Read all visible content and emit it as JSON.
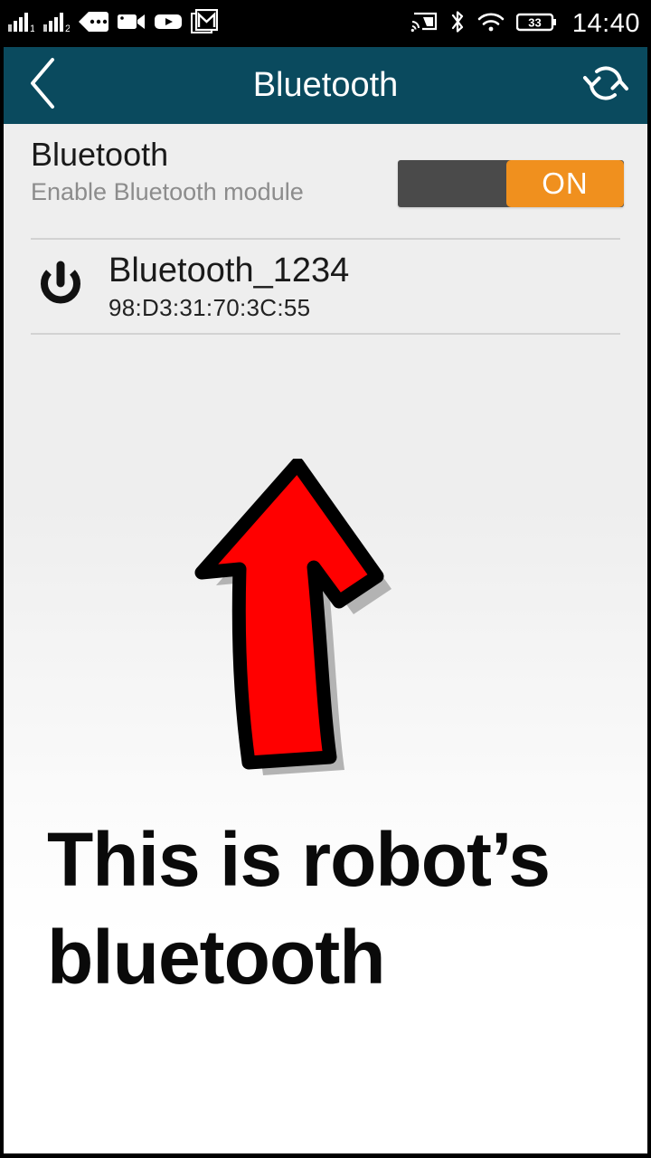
{
  "status_bar": {
    "left_icons": [
      {
        "name": "signal-bars-sim1-icon",
        "label": "1"
      },
      {
        "name": "signal-bars-sim2-icon",
        "label": "2"
      },
      {
        "name": "message-bubble-icon",
        "label": ""
      },
      {
        "name": "video-camera-icon",
        "label": ""
      },
      {
        "name": "youtube-play-icon",
        "label": ""
      },
      {
        "name": "gmail-icon",
        "label": ""
      }
    ],
    "right_icons": [
      {
        "name": "cast-screen-icon"
      },
      {
        "name": "bluetooth-icon"
      },
      {
        "name": "wifi-icon"
      }
    ],
    "battery_level": "33",
    "time": "14:40"
  },
  "action_bar": {
    "back_icon": "chevron-left-icon",
    "title": "Bluetooth",
    "refresh_icon": "refresh-icon",
    "background_color": "#0a4a5e"
  },
  "settings": {
    "bluetooth_toggle": {
      "heading": "Bluetooth",
      "subtitle": "Enable Bluetooth module",
      "state_label": "ON",
      "track_color": "#4a4a4a",
      "thumb_color": "#f0901e"
    },
    "devices": [
      {
        "icon": "power-icon",
        "name": "Bluetooth_1234",
        "mac_address": "98:D3:31:70:3C:55"
      }
    ]
  },
  "annotation": {
    "arrow_icon": "red-up-arrow-icon",
    "arrow_fill_color": "#ff0000",
    "arrow_outline_color": "#000000",
    "arrow_shadow_color": "#b3b3b3",
    "text": "This is robot’s bluetooth"
  }
}
